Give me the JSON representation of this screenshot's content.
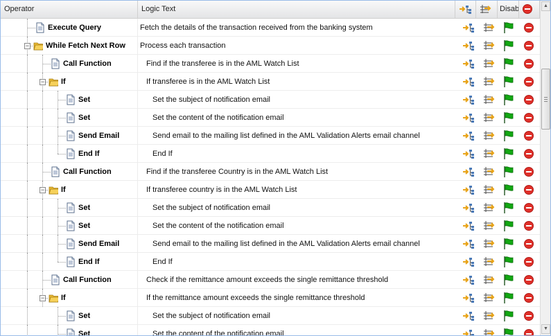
{
  "columns": {
    "operator": "Operator",
    "logic_text": "Logic Text",
    "disable": "Disab"
  },
  "colors": {
    "header_border": "#99bbe8",
    "folder": "#f6d15a",
    "flag": "#12a812",
    "remove": "#e0302a",
    "arrow": "#e8a317"
  },
  "rows": [
    {
      "label": "Execute Query",
      "logic": "Fetch the details of the transaction received from the banking system",
      "depth": 1,
      "type": "doc",
      "last": false,
      "expanded": false
    },
    {
      "label": "While Fetch Next Row",
      "logic": "Process each transaction",
      "depth": 1,
      "type": "folder",
      "last": false,
      "expanded": true
    },
    {
      "label": "Call Function",
      "logic": "Find if the transferee is in the AML Watch List",
      "depth": 2,
      "type": "doc",
      "last": false,
      "expanded": false
    },
    {
      "label": "If",
      "logic": "If transferee is in the AML Watch List",
      "depth": 2,
      "type": "folder",
      "last": false,
      "expanded": true
    },
    {
      "label": "Set",
      "logic": "Set the subject of notification email",
      "depth": 3,
      "type": "doc",
      "last": false,
      "expanded": false
    },
    {
      "label": "Set",
      "logic": "Set the content of the notification email",
      "depth": 3,
      "type": "doc",
      "last": false,
      "expanded": false
    },
    {
      "label": "Send Email",
      "logic": "Send email to the mailing list defined in the AML Validation Alerts email channel",
      "depth": 3,
      "type": "doc",
      "last": false,
      "expanded": false
    },
    {
      "label": "End If",
      "logic": "End If",
      "depth": 3,
      "type": "doc",
      "last": true,
      "expanded": false
    },
    {
      "label": "Call Function",
      "logic": "Find if the transferee Country is in the AML Watch List",
      "depth": 2,
      "type": "doc",
      "last": false,
      "expanded": false
    },
    {
      "label": "If",
      "logic": "If transferee country is in the AML Watch List",
      "depth": 2,
      "type": "folder",
      "last": false,
      "expanded": true
    },
    {
      "label": "Set",
      "logic": "Set the subject of notification email",
      "depth": 3,
      "type": "doc",
      "last": false,
      "expanded": false
    },
    {
      "label": "Set",
      "logic": "Set the content of the notification email",
      "depth": 3,
      "type": "doc",
      "last": false,
      "expanded": false
    },
    {
      "label": "Send Email",
      "logic": "Send email to the mailing list defined in the AML Validation Alerts email channel",
      "depth": 3,
      "type": "doc",
      "last": false,
      "expanded": false
    },
    {
      "label": "End If",
      "logic": "End If",
      "depth": 3,
      "type": "doc",
      "last": true,
      "expanded": false
    },
    {
      "label": "Call Function",
      "logic": "Check if the remittance amount exceeds the single remittance threshold",
      "depth": 2,
      "type": "doc",
      "last": false,
      "expanded": false
    },
    {
      "label": "If",
      "logic": "If the remittance amount exceeds the single remittance threshold",
      "depth": 2,
      "type": "folder",
      "last": false,
      "expanded": true
    },
    {
      "label": "Set",
      "logic": "Set the subject of notification email",
      "depth": 3,
      "type": "doc",
      "last": false,
      "expanded": false
    },
    {
      "label": "Set",
      "logic": "Set the content of the notification email",
      "depth": 3,
      "type": "doc",
      "last": false,
      "expanded": false
    }
  ],
  "icons": {
    "add_child": "add-child-icon",
    "insert_after": "insert-after-icon",
    "enabled_flag": "green-flag-icon",
    "remove": "remove-icon"
  }
}
